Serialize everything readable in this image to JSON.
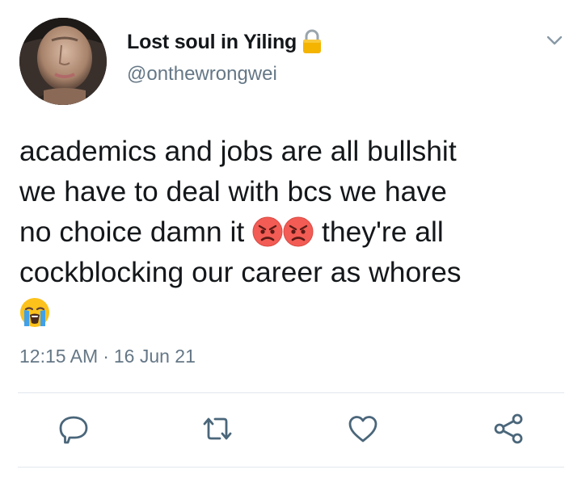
{
  "tweet": {
    "display_name": "Lost soul in Yiling",
    "handle": "@onthewrongwei",
    "text_lines": {
      "line1": "academics and jobs are all bullshit",
      "line2": "we have to deal with bcs we have",
      "line3_before": "no choice damn it",
      "line3_after": "they're all",
      "line4": "cockblocking our career as whores"
    },
    "emoji": {
      "angry_1": "pouting-face",
      "angry_2": "pouting-face",
      "crying": "loudly-crying-face"
    },
    "time": "12:15 AM",
    "date": "16 Jun 21",
    "separator": "·"
  },
  "icons": {
    "lock": "lock-icon",
    "caret": "chevron-down-icon",
    "reply": "reply-icon",
    "retweet": "retweet-icon",
    "like": "heart-icon",
    "share": "share-icon"
  },
  "colors": {
    "text": "#14171a",
    "secondary": "#657786",
    "action_icon": "#4a667a",
    "divider": "#e1e8ed",
    "lock": "#f4b400"
  }
}
